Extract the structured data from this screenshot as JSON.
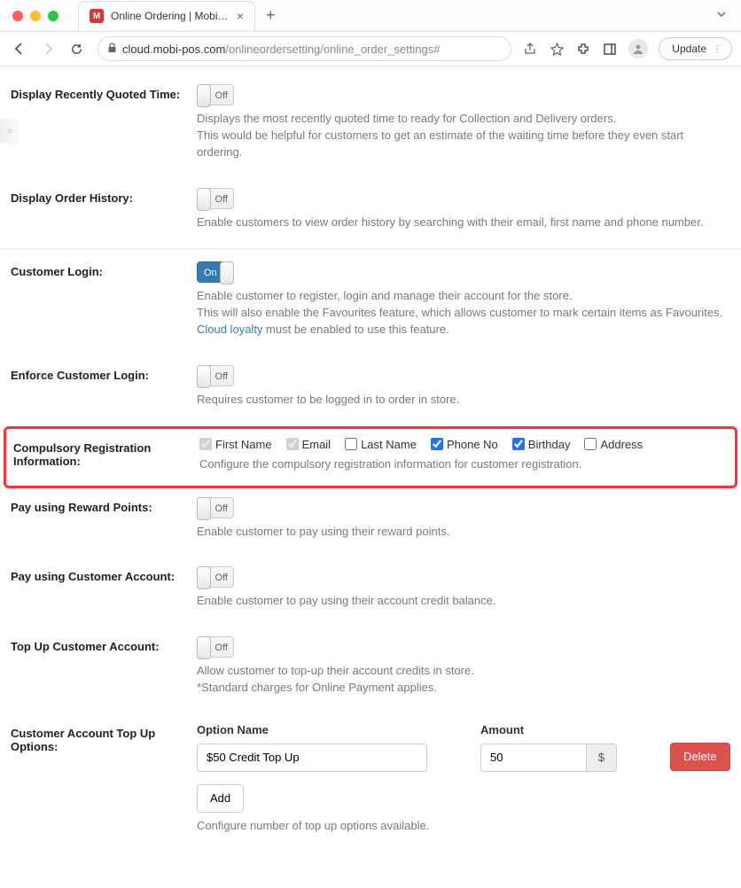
{
  "browser": {
    "tab_title": "Online Ordering | MobiPOS",
    "url_host": "cloud.mobi-pos.com",
    "url_path": "/onlineordersetting/online_order_settings#",
    "update_label": "Update"
  },
  "toggles": {
    "on": "On",
    "off": "Off"
  },
  "settings": {
    "quoted_time": {
      "label": "Display Recently Quoted Time:",
      "help1": "Displays the most recently quoted time to ready for Collection and Delivery orders.",
      "help2": "This would be helpful for customers to get an estimate of the waiting time before they even start ordering."
    },
    "order_history": {
      "label": "Display Order History:",
      "help": "Enable customers to view order history by searching with their email, first name and phone number."
    },
    "customer_login": {
      "label": "Customer Login:",
      "help1": "Enable customer to register, login and manage their account for the store.",
      "help2": "This will also enable the Favourites feature, which allows customer to mark certain items as Favourites.",
      "link_text": "Cloud loyalty",
      "help3": " must be enabled to use this feature."
    },
    "enforce_login": {
      "label": "Enforce Customer Login:",
      "help": "Requires customer to be logged in to order in store."
    },
    "compulsory_reg": {
      "label": "Compulsory Registration Information:",
      "help": "Configure the compulsory registration information for customer registration.",
      "fields": {
        "first_name": "First Name",
        "email": "Email",
        "last_name": "Last Name",
        "phone": "Phone No",
        "birthday": "Birthday",
        "address": "Address"
      }
    },
    "reward_points": {
      "label": "Pay using Reward Points:",
      "help": "Enable customer to pay using their reward points."
    },
    "customer_account": {
      "label": "Pay using Customer Account:",
      "help": "Enable customer to pay using their account credit balance."
    },
    "topup_account": {
      "label": "Top Up Customer Account:",
      "help1": "Allow customer to top-up their account credits in store.",
      "help2": "*Standard charges for Online Payment applies."
    },
    "topup_options": {
      "label": "Customer Account Top Up Options:",
      "option_name_label": "Option Name",
      "amount_label": "Amount",
      "option_name_value": "$50 Credit Top Up",
      "amount_value": "50",
      "currency": "$",
      "delete_label": "Delete",
      "add_label": "Add",
      "help": "Configure number of top up options available."
    }
  }
}
